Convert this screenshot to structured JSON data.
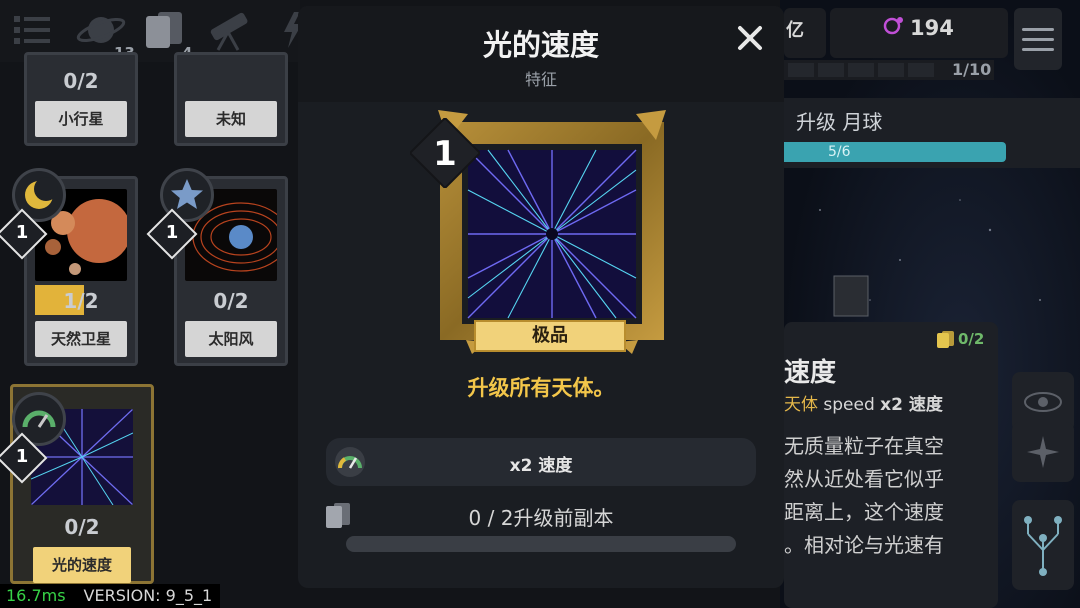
{
  "top_bar": {
    "tabs": [
      {
        "icon": "checklist-icon",
        "count": ""
      },
      {
        "icon": "planet-icon",
        "count": "13"
      },
      {
        "icon": "cards-icon",
        "count": "4"
      },
      {
        "icon": "telescope-icon",
        "count": ""
      },
      {
        "icon": "lightning-icon",
        "count": ""
      }
    ],
    "resource_partial": "亿",
    "gems": "194",
    "stage_progress": "1/10"
  },
  "upgrade": {
    "label": "升级 月球",
    "progress": "5/6",
    "progress_fraction": 0.833
  },
  "cards": [
    {
      "count": "0/2",
      "label": "小行星"
    },
    {
      "count": "",
      "label": "未知"
    },
    {
      "count": "1/2",
      "label": "天然卫星",
      "level": "1",
      "progress_fraction": 0.5
    },
    {
      "count": "0/2",
      "label": "太阳风",
      "level": "1"
    },
    {
      "count": "0/2",
      "label": "光的速度",
      "level": "1"
    }
  ],
  "modal": {
    "title": "光的速度",
    "subtitle": "特征",
    "level": "1",
    "rarity": "极品",
    "description": "升级所有天体。",
    "effect": "x2 速度",
    "copies_text": "0 / 2升级前副本",
    "copies_fraction": 0
  },
  "info_panel": {
    "title_partial": "速度",
    "tag_gold": "天体",
    "tag_speed": "speed",
    "tag_effect": "x2 速度",
    "copies": "0/2",
    "description_lines": [
      "无质量粒子在真空",
      "然从近处看它似乎",
      "距离上，这个速度",
      "。相对论与光速有"
    ]
  },
  "debug": {
    "fps": "16.7ms",
    "version": "VERSION: 9_5_1"
  },
  "colors": {
    "gold": "#f3c64a",
    "accent_teal": "#3aa3b0",
    "fps_green": "#37d447"
  }
}
